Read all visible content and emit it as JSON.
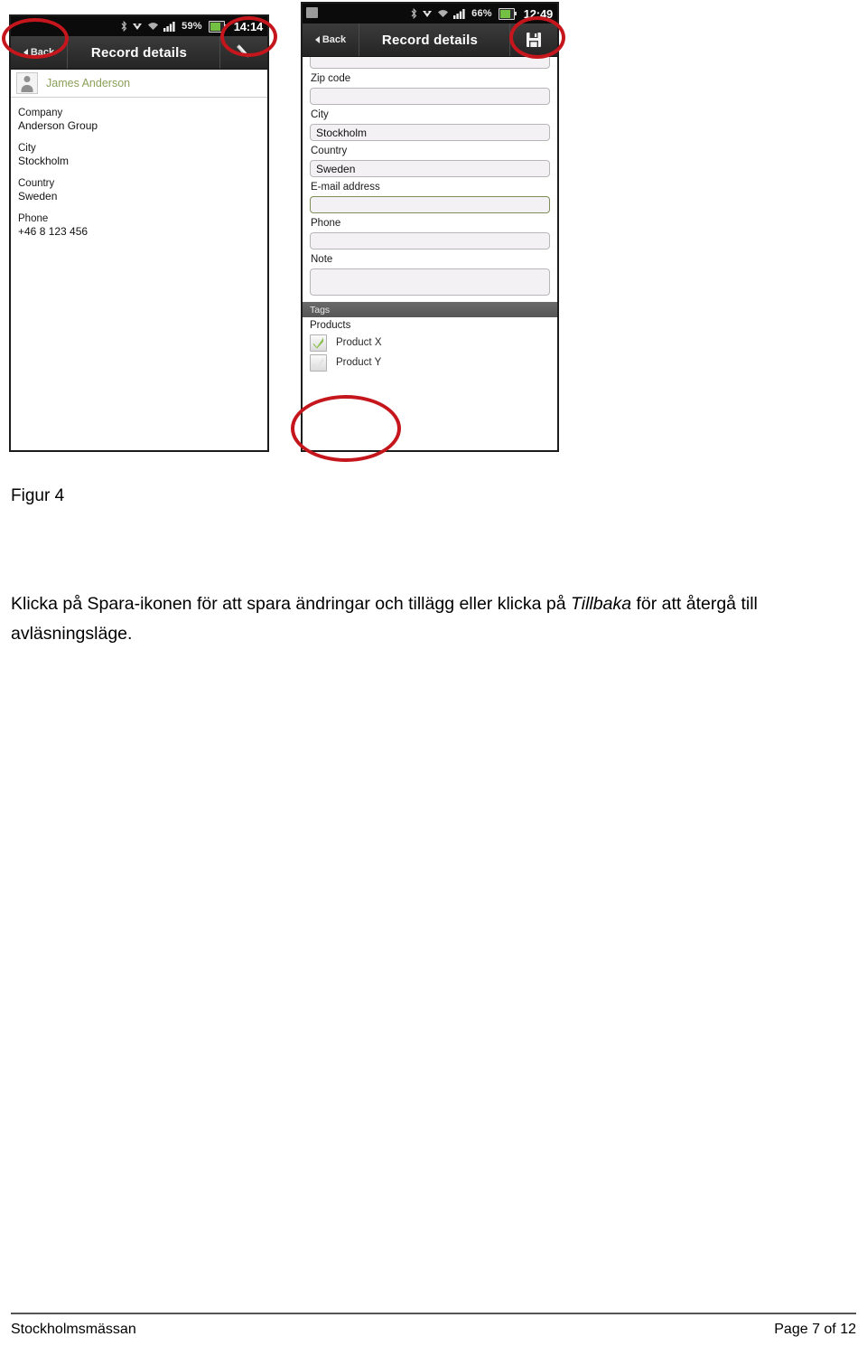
{
  "document": {
    "figure_caption": "Figur 4",
    "paragraph_part1": "Klicka på Spara-ikonen för att spara ändringar och tillägg eller klicka på ",
    "paragraph_emphasis": "Tillbaka",
    "paragraph_part2": " för att återgå till avläsningsläge.",
    "footer_left": "Stockholmsmässan",
    "footer_right": "Page 7 of 12"
  },
  "colors": {
    "annotation_red": "#c4161c",
    "name_green": "#89a05a",
    "check_green": "#8cc152",
    "actionbar_dark": "#2b2b2b",
    "tags_gray": "#5f5f5f"
  },
  "phone_left": {
    "status_bar": {
      "bluetooth_icon": "bluetooth-icon",
      "sync_icon": "sync-icon",
      "wifi_icon": "wifi-icon",
      "signal_icon": "signal-bars-icon",
      "battery_percent": "59%",
      "battery_icon": "battery-icon",
      "time": "14:14"
    },
    "action_bar": {
      "back_label": "Back",
      "back_icon": "back-triangle-icon",
      "title": "Record details",
      "action_icon": "pencil-edit-icon"
    },
    "contact": {
      "avatar_icon": "person-avatar-icon",
      "name": "James Anderson"
    },
    "fields": [
      {
        "label": "Company",
        "value": "Anderson Group"
      },
      {
        "label": "City",
        "value": "Stockholm"
      },
      {
        "label": "Country",
        "value": "Sweden"
      },
      {
        "label": "Phone",
        "value": "+46 8 123 456"
      }
    ]
  },
  "phone_right": {
    "status_bar": {
      "left_icon": "gallery-icon",
      "bluetooth_icon": "bluetooth-icon",
      "sync_icon": "sync-icon",
      "wifi_icon": "wifi-icon",
      "signal_icon": "signal-bars-icon",
      "battery_percent": "66%",
      "battery_icon": "battery-icon",
      "time": "12:49"
    },
    "action_bar": {
      "back_label": "Back",
      "back_icon": "back-triangle-icon",
      "title": "Record details",
      "action_icon": "save-floppy-icon"
    },
    "fields": [
      {
        "label": "Zip code",
        "value": ""
      },
      {
        "label": "City",
        "value": "Stockholm"
      },
      {
        "label": "Country",
        "value": "Sweden"
      },
      {
        "label": "E-mail address",
        "value": ""
      },
      {
        "label": "Phone",
        "value": ""
      },
      {
        "label": "Note",
        "value": ""
      }
    ],
    "tags_section": {
      "header": "Tags",
      "group_title": "Products",
      "items": [
        {
          "label": "Product X",
          "checked": true
        },
        {
          "label": "Product Y",
          "checked": false
        }
      ]
    }
  }
}
